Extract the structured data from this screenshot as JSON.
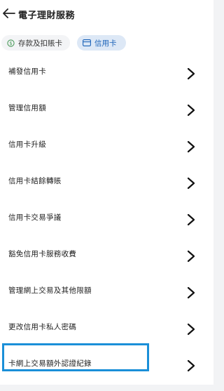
{
  "header": {
    "title": "電子理財服務",
    "back_icon": "arrow-left-icon"
  },
  "tabs": [
    {
      "label": "存款及扣賬卡",
      "icon": "dollar-circle-icon",
      "active": false
    },
    {
      "label": "信用卡",
      "icon": "card-icon",
      "active": true
    }
  ],
  "items": [
    {
      "label": "補發信用卡"
    },
    {
      "label": "管理信用額"
    },
    {
      "label": "信用卡升級"
    },
    {
      "label": "信用卡結餘轉賬"
    },
    {
      "label": "信用卡交易爭議"
    },
    {
      "label": "豁免信用卡服務收費"
    },
    {
      "label": "管理網上交易及其他限額"
    },
    {
      "label": "更改信用卡私人密碼"
    },
    {
      "label": "卡網上交易額外認證紀錄"
    }
  ],
  "highlight_color": "#1a8fd8",
  "accent_color": "#1a62b8"
}
